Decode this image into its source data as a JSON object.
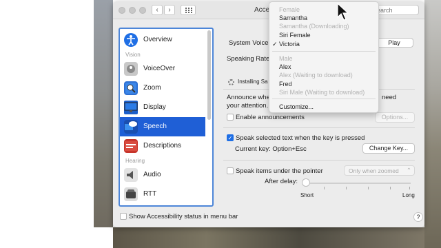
{
  "window": {
    "title": "Accessibility",
    "search_placeholder": "Search"
  },
  "sidebar": {
    "items": [
      {
        "label": "Overview",
        "icon": "accessibility-icon"
      },
      {
        "label": "VoiceOver",
        "icon": "voiceover-icon"
      },
      {
        "label": "Zoom",
        "icon": "zoom-icon"
      },
      {
        "label": "Display",
        "icon": "display-icon"
      },
      {
        "label": "Speech",
        "icon": "speech-icon"
      },
      {
        "label": "Descriptions",
        "icon": "descriptions-icon"
      },
      {
        "label": "Audio",
        "icon": "speaker-icon"
      },
      {
        "label": "RTT",
        "icon": "phone-icon"
      }
    ],
    "sections": {
      "vision": "Vision",
      "hearing": "Hearing"
    },
    "selected": "Speech"
  },
  "speech": {
    "system_voice_label": "System Voice",
    "play_button": "Play",
    "speaking_rate_label": "Speaking Rate",
    "installing_text": "Installing Sa",
    "announce_line1": "Announce whe",
    "announce_line1_end": "need",
    "announce_line2": "your attention.",
    "enable_announcements": "Enable announcements",
    "options_button": "Options...",
    "speak_selected": "Speak selected text when the key is pressed",
    "current_key": "Current key: Option+Esc",
    "change_key_button": "Change Key...",
    "speak_pointer": "Speak items under the pointer",
    "pointer_mode": "Only when zoomed",
    "after_delay": "After delay:",
    "slider_short": "Short",
    "slider_long": "Long",
    "slider_value": 0
  },
  "footer": {
    "show_status": "Show Accessibility status in menu bar",
    "help": "?"
  },
  "voice_menu": {
    "female_header": "Female",
    "female": [
      {
        "label": "Samantha",
        "enabled": true
      },
      {
        "label": "Samantha (Downloading)",
        "enabled": false
      },
      {
        "label": "Siri Female",
        "enabled": true
      },
      {
        "label": "Victoria",
        "enabled": true,
        "checked": true
      }
    ],
    "check_mark": "✓",
    "male_header": "Male",
    "male": [
      {
        "label": "Alex",
        "enabled": true
      },
      {
        "label": "Alex (Waiting to download)",
        "enabled": false
      },
      {
        "label": "Fred",
        "enabled": true
      },
      {
        "label": "Siri Male (Waiting to download)",
        "enabled": false
      }
    ],
    "customize": "Customize..."
  },
  "colors": {
    "accent": "#1f5fd6",
    "checkbox_blue": "#1f6fe5"
  }
}
